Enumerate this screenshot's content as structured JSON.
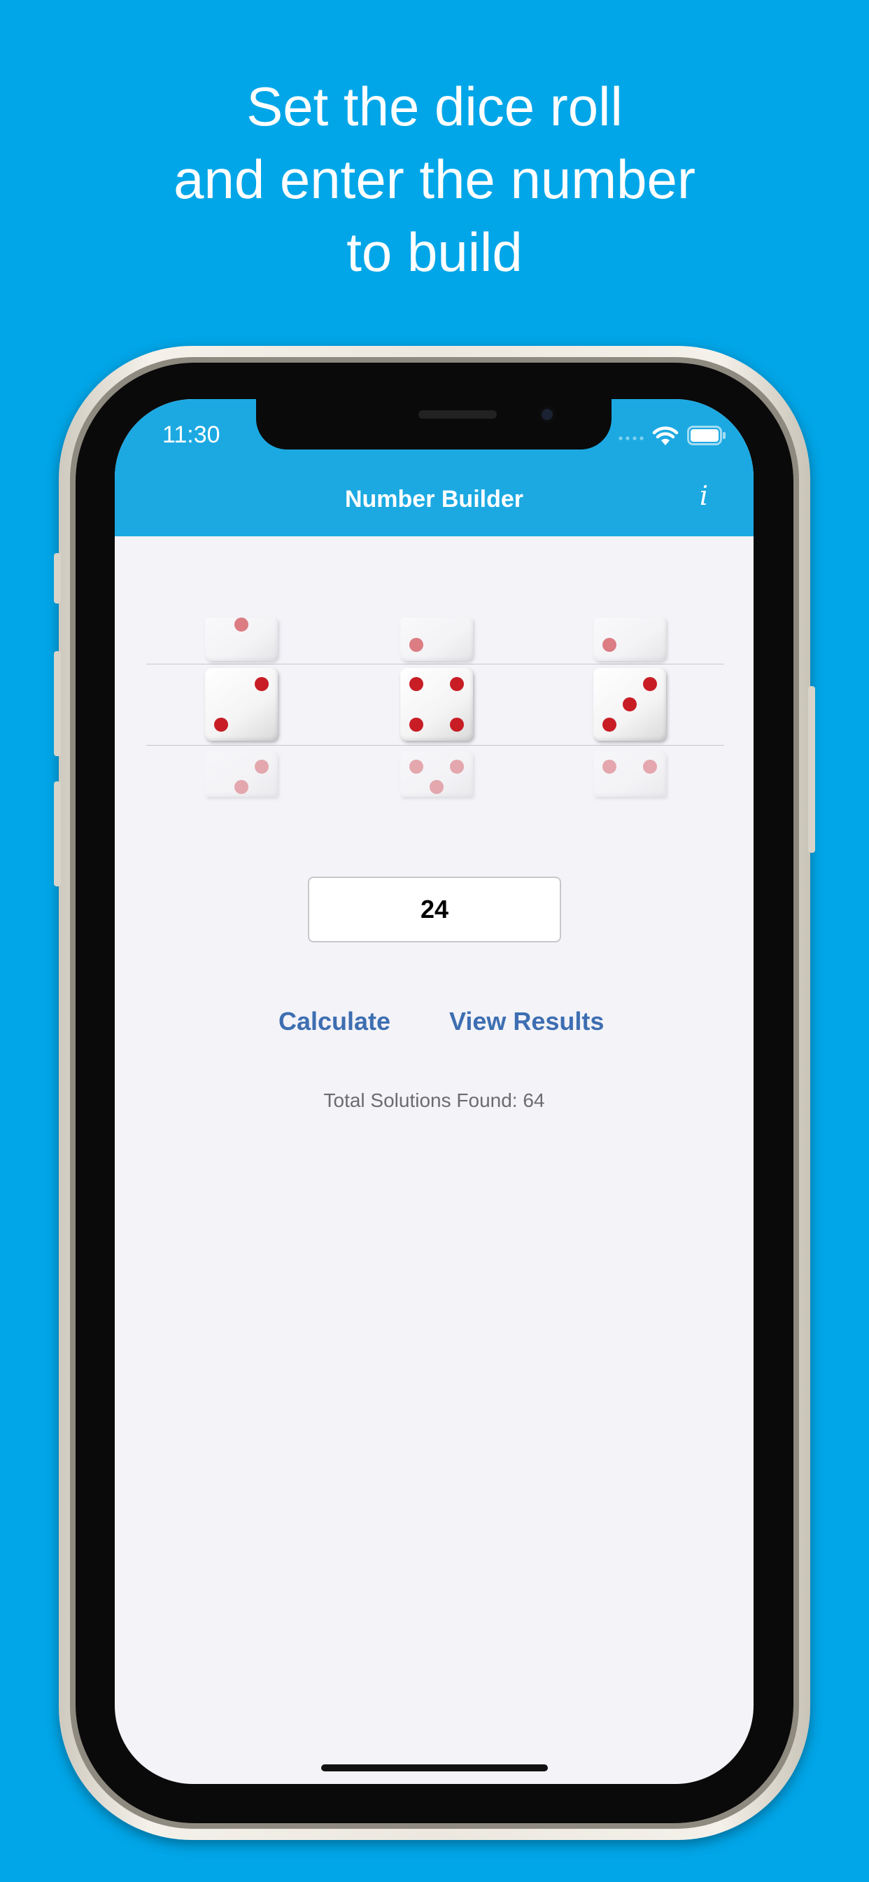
{
  "marketing": {
    "line1": "Set the dice roll",
    "line2": "and enter the number",
    "line3": "to build"
  },
  "status_bar": {
    "time": "11:30",
    "icons": [
      "signal-icon",
      "wifi-icon",
      "battery-icon"
    ]
  },
  "nav": {
    "title": "Number Builder",
    "info_label": "i"
  },
  "dice": {
    "selected": [
      2,
      4,
      3
    ],
    "above": [
      1,
      2,
      2
    ],
    "below": [
      3,
      5,
      4
    ],
    "pip_color": "#c81d25"
  },
  "input": {
    "value": "24"
  },
  "actions": {
    "calculate_label": "Calculate",
    "view_results_label": "View Results"
  },
  "results": {
    "summary": "Total Solutions Found: 64"
  },
  "colors": {
    "background": "#00a6e8",
    "navbar": "#1ca9e2",
    "link": "#3d6eb1",
    "screen": "#f3f3f8"
  }
}
